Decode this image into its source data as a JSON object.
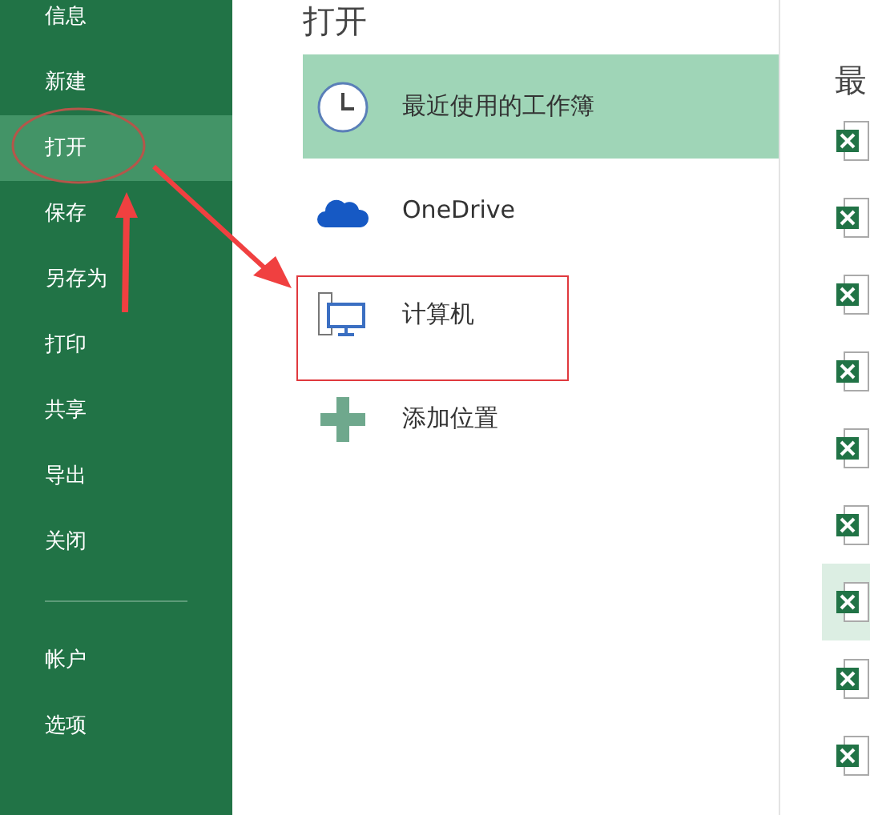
{
  "sidebar": {
    "items": [
      {
        "label": "信息",
        "selected": false
      },
      {
        "label": "新建",
        "selected": false
      },
      {
        "label": "打开",
        "selected": true
      },
      {
        "label": "保存",
        "selected": false
      },
      {
        "label": "另存为",
        "selected": false
      },
      {
        "label": "打印",
        "selected": false
      },
      {
        "label": "共享",
        "selected": false
      },
      {
        "label": "导出",
        "selected": false
      },
      {
        "label": "关闭",
        "selected": false
      }
    ],
    "bottom_items": [
      {
        "label": "帐户",
        "selected": false
      },
      {
        "label": "选项",
        "selected": false
      }
    ]
  },
  "page_title": "打开",
  "places": [
    {
      "kind": "recent",
      "label": "最近使用的工作簿",
      "selected": true
    },
    {
      "kind": "onedrive",
      "label": "OneDrive",
      "selected": false
    },
    {
      "kind": "computer",
      "label": "计算机",
      "selected": false
    },
    {
      "kind": "add",
      "label": "添加位置",
      "selected": false
    }
  ],
  "recent": {
    "heading": "最",
    "files": [
      {
        "selected": false
      },
      {
        "selected": false
      },
      {
        "selected": false
      },
      {
        "selected": false
      },
      {
        "selected": false
      },
      {
        "selected": false
      },
      {
        "selected": true
      },
      {
        "selected": false
      },
      {
        "selected": false
      }
    ]
  }
}
